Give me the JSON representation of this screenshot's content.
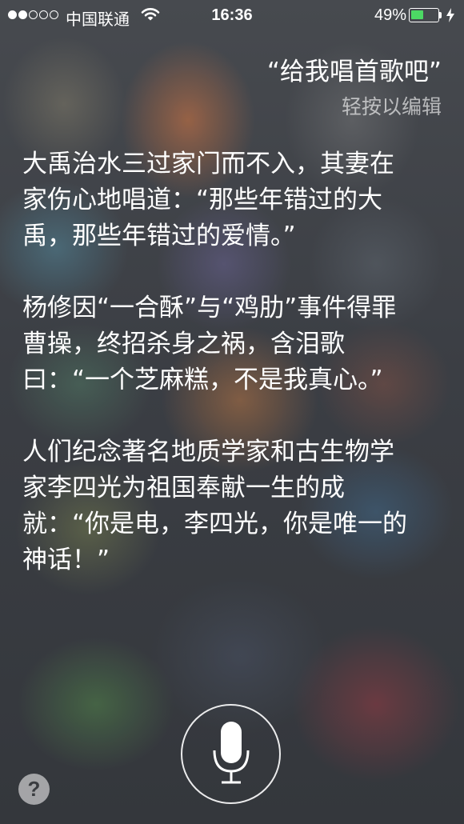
{
  "status_bar": {
    "signal_dots_total": 5,
    "signal_dots_filled": 2,
    "carrier": "中国联通",
    "wifi_icon": "wifi-icon",
    "time": "16:36",
    "battery_percent_text": "49%",
    "battery_level": 0.49,
    "battery_color": "#4cd964",
    "charging_icon": "lightning-icon"
  },
  "query": {
    "text": "“给我唱首歌吧”",
    "edit_hint": "轻按以编辑"
  },
  "response": {
    "paragraphs": [
      "大禹治水三过家门而不入，其妻在家伤心地唱道：“那些年错过的大禹，那些年错过的爱情。”",
      "杨修因“一合酥”与“鸡肋”事件得罪曹操，终招杀身之祸，含泪歌曰：“一个芝麻糕，不是我真心。”",
      "人们纪念著名地质学家和古生物学家李四光为祖国奉献一生的成就：“你是电，李四光，你是唯一的神话！”"
    ]
  },
  "controls": {
    "mic_icon": "microphone-icon",
    "help_label": "?"
  }
}
